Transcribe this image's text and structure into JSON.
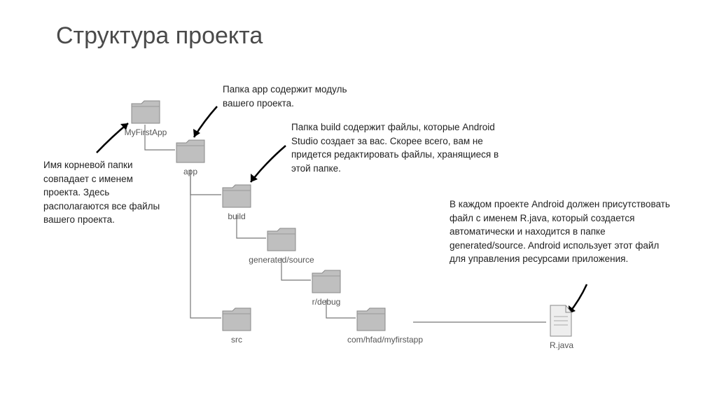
{
  "title": "Структура проекта",
  "nodes": {
    "root": {
      "label": "MyFirstApp"
    },
    "app": {
      "label": "app"
    },
    "build": {
      "label": "build"
    },
    "generated": {
      "label": "generated/source"
    },
    "rdebug": {
      "label": "r/debug"
    },
    "comhfad": {
      "label": "com/hfad/myfirstapp"
    },
    "src": {
      "label": "src"
    },
    "rjava": {
      "label": "R.java"
    }
  },
  "annotations": {
    "app_note": "Папка app содержит модуль вашего проекта.",
    "root_note": "Имя корневой папки совпадает с именем проекта. Здесь располагаются все файлы вашего проекта.",
    "build_note": "Папка build содержит файлы, которые Android Studio создает за вас. Скорее всего, вам не придется редактировать файлы, хранящиеся в этой папке.",
    "rjava_note": "В каждом проекте Android должен присутствовать файл с именем R.java, который создается автоматически и находится в папке generated/source. Android использует этот файл для управления ресурсами приложения."
  }
}
